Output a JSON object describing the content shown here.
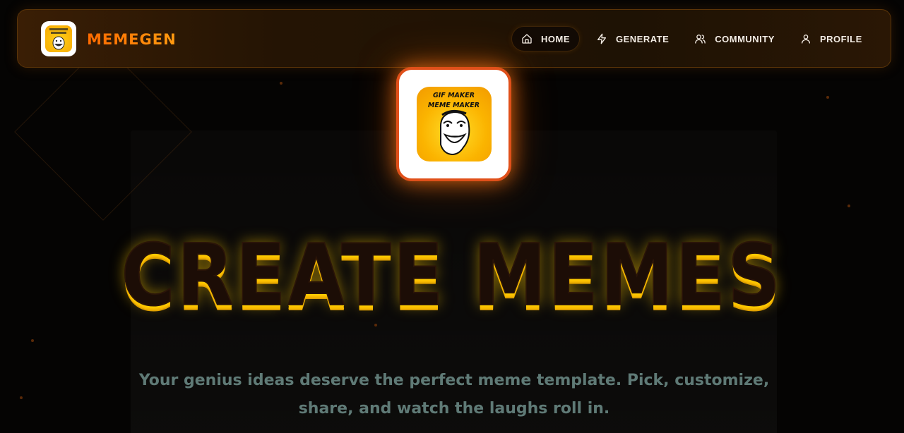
{
  "brand": {
    "name": "MEMEGEN",
    "logo_icon": "troll-face-icon"
  },
  "nav": {
    "items": [
      {
        "label": "HOME",
        "icon": "home-icon",
        "active": true
      },
      {
        "label": "GENERATE",
        "icon": "lightning-icon",
        "active": false
      },
      {
        "label": "COMMUNITY",
        "icon": "users-icon",
        "active": false
      },
      {
        "label": "PROFILE",
        "icon": "user-icon",
        "active": false
      }
    ]
  },
  "hero": {
    "logo_text_line1": "GIF MAKER",
    "logo_text_line2": "MEME MAKER",
    "headline": "CREATE MEMES",
    "tagline": "Your genius ideas deserve the perfect meme template. Pick, customize, share, and watch the laughs roll in."
  },
  "colors": {
    "accent": "#ff7a00",
    "headline_glow": "#ffd000",
    "tagline": "#5f7a76",
    "background": "#050403"
  }
}
